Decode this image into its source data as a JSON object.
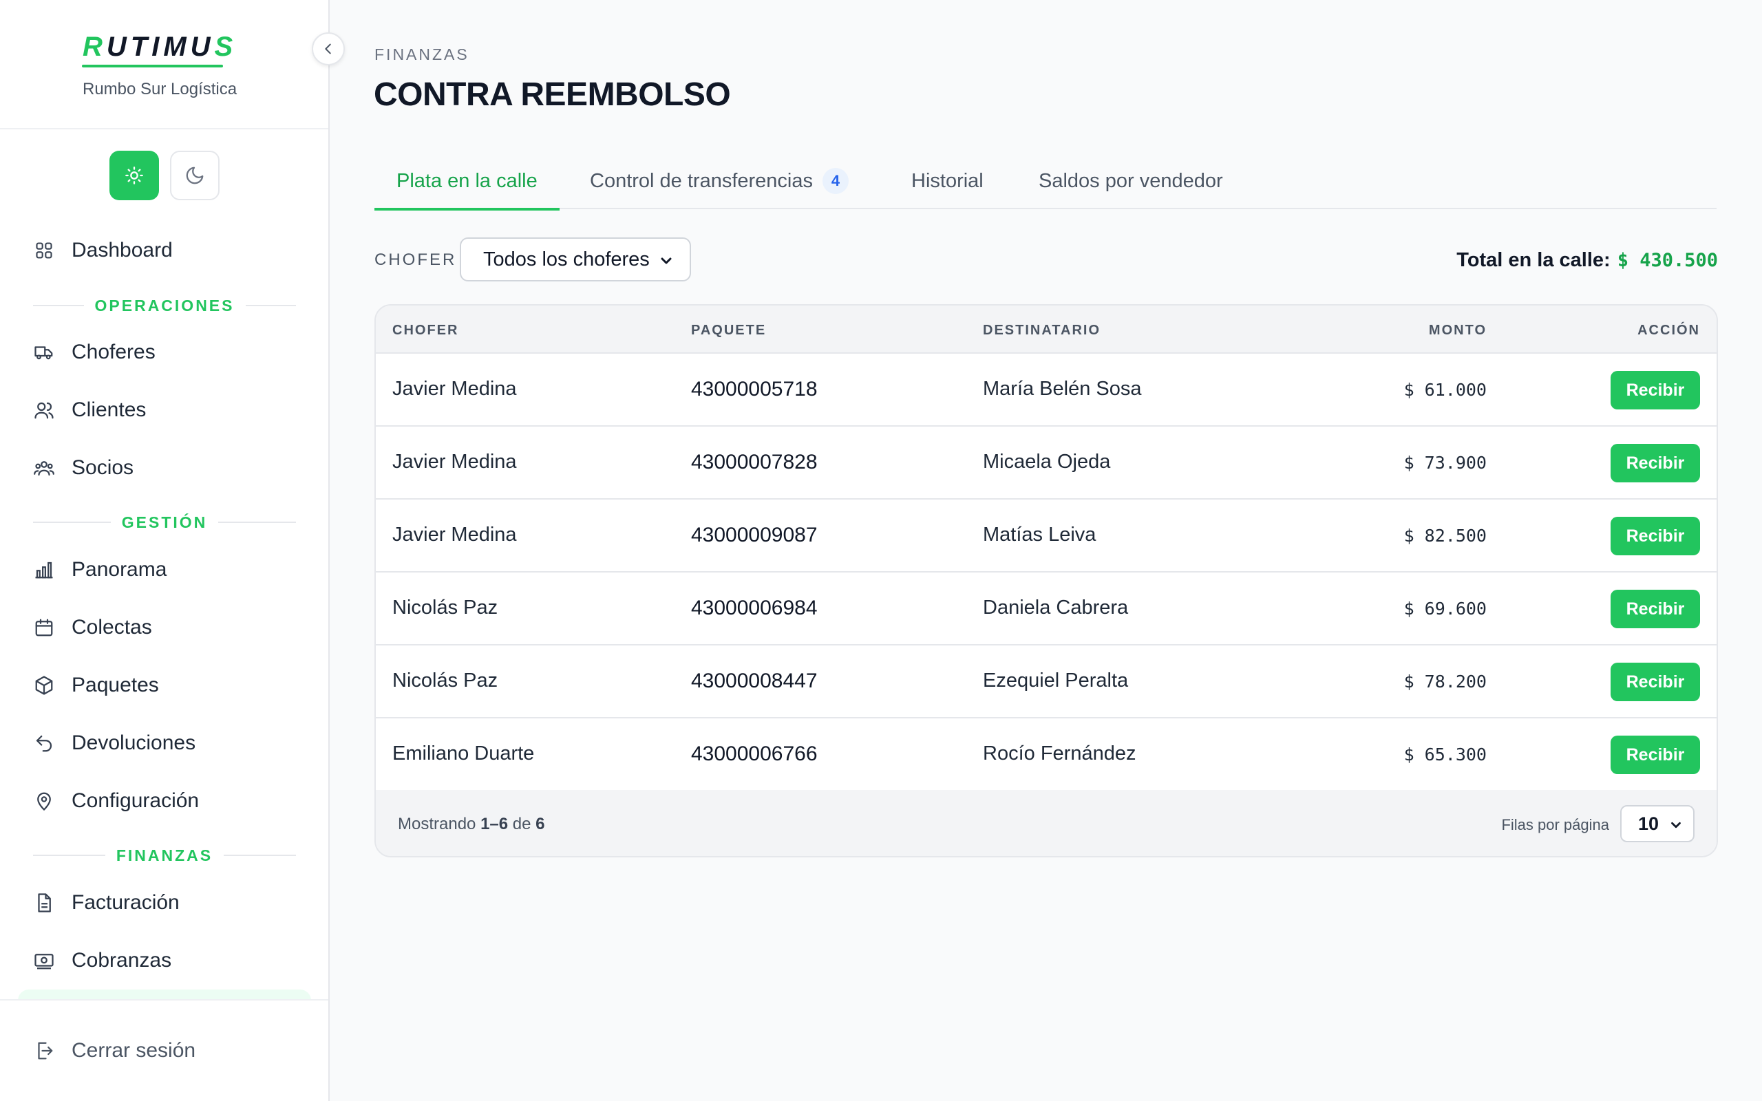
{
  "brand": {
    "logo_prefix": "R",
    "logo_middle": "UTIMU",
    "logo_suffix": "S",
    "subtitle": "Rumbo Sur Logística"
  },
  "colors": {
    "accent": "#22c55e",
    "accent_dark": "#16a34a",
    "badge_blue": "#2563eb"
  },
  "sidebar": {
    "dashboard": {
      "label": "Dashboard",
      "icon": "grid-icon"
    },
    "section_operaciones": "OPERACIONES",
    "choferes": {
      "label": "Choferes",
      "icon": "truck-icon"
    },
    "clientes": {
      "label": "Clientes",
      "icon": "users-icon"
    },
    "socios": {
      "label": "Socios",
      "icon": "group-icon"
    },
    "section_gestion": "GESTIÓN",
    "panorama": {
      "label": "Panorama",
      "icon": "bar-chart-icon"
    },
    "colectas": {
      "label": "Colectas",
      "icon": "calendar-icon"
    },
    "paquetes": {
      "label": "Paquetes",
      "icon": "box-icon"
    },
    "devoluciones": {
      "label": "Devoluciones",
      "icon": "return-arrow-icon"
    },
    "configuracion": {
      "label": "Configuración",
      "icon": "map-pin-icon"
    },
    "section_finanzas": "FINANZAS",
    "facturacion": {
      "label": "Facturación",
      "icon": "document-icon"
    },
    "cobranzas": {
      "label": "Cobranzas",
      "icon": "banknote-icon"
    },
    "logout": {
      "label": "Cerrar sesión",
      "icon": "logout-icon"
    }
  },
  "header": {
    "breadcrumb": "FINANZAS",
    "title": "CONTRA REEMBOLSO"
  },
  "tabs": [
    {
      "label": "Plata en la calle",
      "active": true
    },
    {
      "label": "Control de transferencias",
      "badge": "4"
    },
    {
      "label": "Historial"
    },
    {
      "label": "Saldos por vendedor"
    }
  ],
  "filter": {
    "label": "CHOFER",
    "selected": "Todos los choferes"
  },
  "total": {
    "label": "Total en la calle:",
    "amount": "$ 430.500"
  },
  "table": {
    "headers": {
      "chofer": "CHOFER",
      "paquete": "PAQUETE",
      "destinatario": "DESTINATARIO",
      "monto": "MONTO",
      "accion": "ACCIÓN"
    },
    "rows": [
      {
        "chofer": "Javier Medina",
        "paquete": "43000005718",
        "destinatario": "María Belén Sosa",
        "monto": "$ 61.000",
        "action": "Recibir"
      },
      {
        "chofer": "Javier Medina",
        "paquete": "43000007828",
        "destinatario": "Micaela Ojeda",
        "monto": "$ 73.900",
        "action": "Recibir"
      },
      {
        "chofer": "Javier Medina",
        "paquete": "43000009087",
        "destinatario": "Matías Leiva",
        "monto": "$ 82.500",
        "action": "Recibir"
      },
      {
        "chofer": "Nicolás Paz",
        "paquete": "43000006984",
        "destinatario": "Daniela Cabrera",
        "monto": "$ 69.600",
        "action": "Recibir"
      },
      {
        "chofer": "Nicolás Paz",
        "paquete": "43000008447",
        "destinatario": "Ezequiel Peralta",
        "monto": "$ 78.200",
        "action": "Recibir"
      },
      {
        "chofer": "Emiliano Duarte",
        "paquete": "43000006766",
        "destinatario": "Rocío Fernández",
        "monto": "$ 65.300",
        "action": "Recibir"
      }
    ],
    "footer": {
      "showing_prefix": "Mostrando",
      "showing_range": "1–6",
      "showing_of": "de",
      "showing_total": "6",
      "rows_per_page_label": "Filas por página",
      "rows_per_page": "10"
    }
  }
}
